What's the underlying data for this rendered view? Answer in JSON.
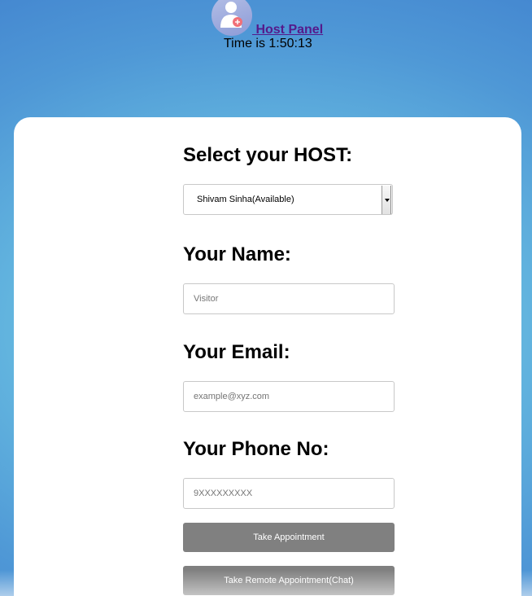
{
  "header": {
    "avatar_icon": "user-add-icon",
    "host_panel_link": " Host Panel",
    "time_prefix": "Time is ",
    "time_value": "1:50:13"
  },
  "form": {
    "host_label": "Select your HOST:",
    "host_selected": "Shivam Sinha(Available)",
    "name_label": "Your Name:",
    "name_placeholder": "Visitor",
    "email_label": "Your Email:",
    "email_placeholder": "example@xyz.com",
    "phone_label": "Your Phone No:",
    "phone_placeholder": "9XXXXXXXXX",
    "take_appointment_label": "Take Appointment",
    "remote_appointment_label": "Take Remote Appointment(Chat)"
  },
  "colors": {
    "accent_link": "#551a8b",
    "button_bg": "#808080",
    "avatar_badge": "#f07078"
  }
}
